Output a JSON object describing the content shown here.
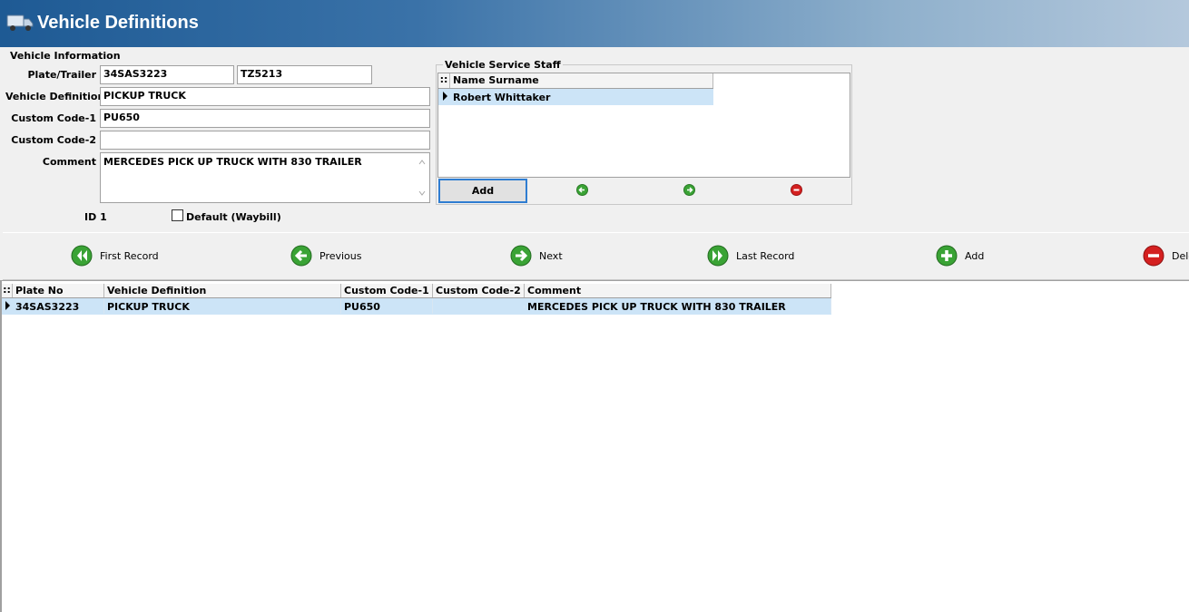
{
  "window": {
    "title": "Vehicle Definitions",
    "title_icon": "truck-icon"
  },
  "vehicle_info": {
    "group_label": "Vehicle Information",
    "plate_label": "Plate/Trailer",
    "plate_value": "34SAS3223",
    "trailer_value": "TZ5213",
    "definition_label": "Vehicle Definition",
    "definition_value": "PICKUP TRUCK",
    "code1_label": "Custom Code-1",
    "code1_value": "PU650",
    "code2_label": "Custom Code-2",
    "code2_value": "",
    "comment_label": "Comment",
    "comment_value": "MERCEDES PICK UP TRUCK WITH 830 TRAILER",
    "id_label": "ID",
    "id_value": "1",
    "default_label": "Default (Waybill)",
    "default_checked": false
  },
  "staff": {
    "group_label": "Vehicle Service Staff",
    "grid_marker": "::",
    "column": "Name Surname",
    "rows": [
      "Robert Whittaker"
    ],
    "add_label": "Add",
    "icons": [
      "green-left-arrow-icon",
      "green-right-arrow-icon",
      "red-minus-icon"
    ]
  },
  "nav": {
    "first_label": "First Record",
    "previous_label": "Previous",
    "next_label": "Next",
    "last_label": "Last Record",
    "add_label": "Add",
    "delete_label": "Dele"
  },
  "grid": {
    "marker": "::",
    "columns": [
      "Plate No",
      "Vehicle Definition",
      "Custom Code-1",
      "Custom Code-2",
      "Comment"
    ],
    "rows": [
      [
        "34SAS3223",
        "PICKUP TRUCK",
        "PU650",
        "",
        "MERCEDES PICK UP TRUCK WITH 830 TRAILER"
      ]
    ]
  },
  "colors": {
    "title_bar_start": "#1e5a94",
    "selection": "#cce4f7",
    "nav_green": "#3aa335",
    "delete_red": "#d42020"
  }
}
